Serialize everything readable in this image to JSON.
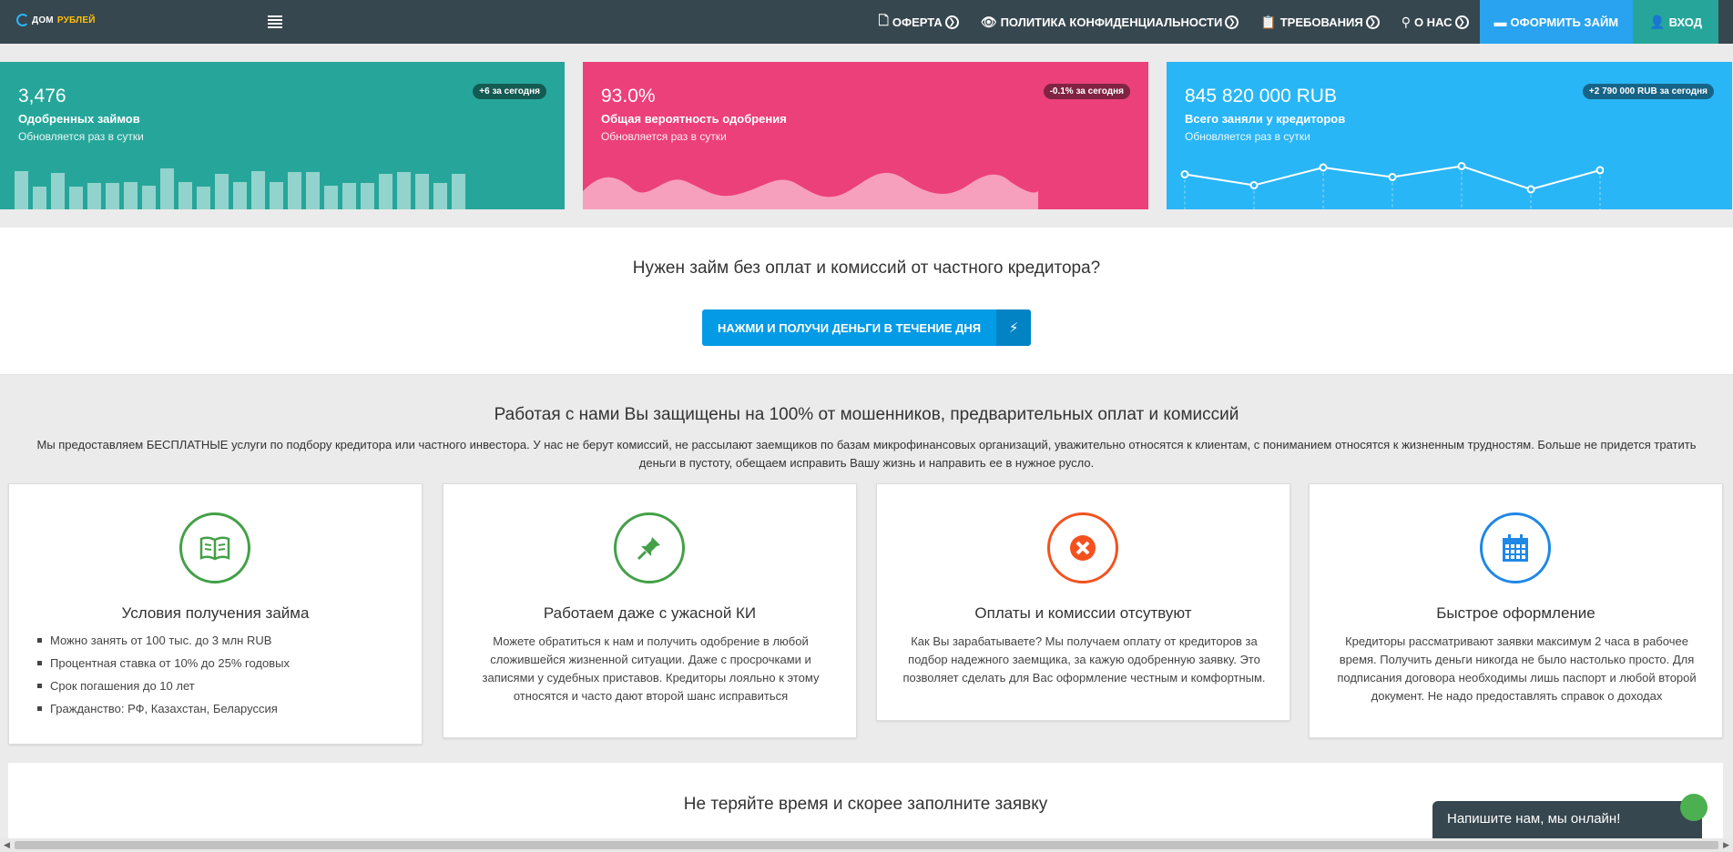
{
  "brand": {
    "part1": "ДОМ",
    "part2": "РУБЛЕЙ"
  },
  "nav": [
    {
      "label": "ОФЕРТА"
    },
    {
      "label": "ПОЛИТИКА КОНФИДЕНЦИАЛЬНОСТИ"
    },
    {
      "label": "ТРЕБОВАНИЯ"
    },
    {
      "label": "О НАС"
    },
    {
      "label": "ОФОРМИТЬ ЗАЙМ"
    },
    {
      "label": "ВХОД"
    }
  ],
  "stats": [
    {
      "value": "3,476",
      "label": "Одобренных займов",
      "sub": "Обновляется раз в сутки",
      "badge": "+6 за сегодня"
    },
    {
      "value": "93.0%",
      "label": "Общая вероятность одобрения",
      "sub": "Обновляется раз в сутки",
      "badge": "-0.1% за сегодня"
    },
    {
      "value": "845 820 000 RUB",
      "label": "Всего заняли у кредиторов",
      "sub": "Обновляется раз в сутки",
      "badge": "+2 790 000 RUB за сегодня"
    }
  ],
  "cta": {
    "title": "Нужен займ без оплат и комиссий от частного кредитора?",
    "button": "НАЖМИ И ПОЛУЧИ ДЕНЬГИ В ТЕЧЕНИЕ ДНЯ"
  },
  "safety": {
    "title": "Работая с нами Вы защищены на 100% от мошенников, предварительных оплат и комиссий",
    "text": "Мы предоставляем БЕСПЛАТНЫЕ услуги по подбору кредитора или частного инвестора. У нас не берут комиссий, не рассылают заемщиков по базам микрофинансовых организаций, уважительно относятся к клиентам, с пониманием относятся к жизненным трудностям. Больше не придется тратить деньги в пустоту, обещаем исправить Вашу жизнь и направить ее в нужное русло."
  },
  "features": [
    {
      "title": "Условия получения займа",
      "items": [
        "Можно занять от 100 тыс. до 3 млн RUB",
        "Процентная ставка от 10% до 25% годовых",
        "Срок погашения до 10 лет",
        "Гражданство: РФ, Казахстан, Беларуссия"
      ]
    },
    {
      "title": "Работаем даже с ужасной КИ",
      "text": "Можете обратиться к нам и получить одобрение в любой сложившейся жизненной ситуации. Даже с просрочками и записями у судебных приставов. Кредиторы лояльно к этому относятся и часто дают второй шанс исправиться"
    },
    {
      "title": "Оплаты и комиссии отсутвуют",
      "text": "Как Вы зарабатываете? Мы получаем оплату от кредиторов за подбор надежного заемщика, за кажую одобренную заявку. Это позволяет сделать для Вас оформление честным и комфортным."
    },
    {
      "title": "Быстрое оформление",
      "text": "Кредиторы рассматривают заявки максимум 2 часа в рабочее время. Получить деньги никогда не было настолько просто. Для подписания договора необходимы лишь паспорт и любой второй документ. Не надо предоставлять справок о доходах"
    }
  ],
  "bottom": {
    "title": "Не теряйте время и скорее заполните заявку"
  },
  "chat": {
    "label": "Напишите нам, мы онлайн!"
  },
  "sparkline": {
    "bar_heights": [
      0.85,
      0.5,
      0.8,
      0.5,
      0.58,
      0.58,
      0.6,
      0.52,
      0.9,
      0.6,
      0.5,
      0.78,
      0.6,
      0.85,
      0.6,
      0.82,
      0.82,
      0.52,
      0.58,
      0.58,
      0.78,
      0.82,
      0.78,
      0.58,
      0.78
    ],
    "line_points": [
      0.45,
      0.85,
      0.2,
      0.55,
      0.15,
      1.0,
      0.3
    ]
  }
}
